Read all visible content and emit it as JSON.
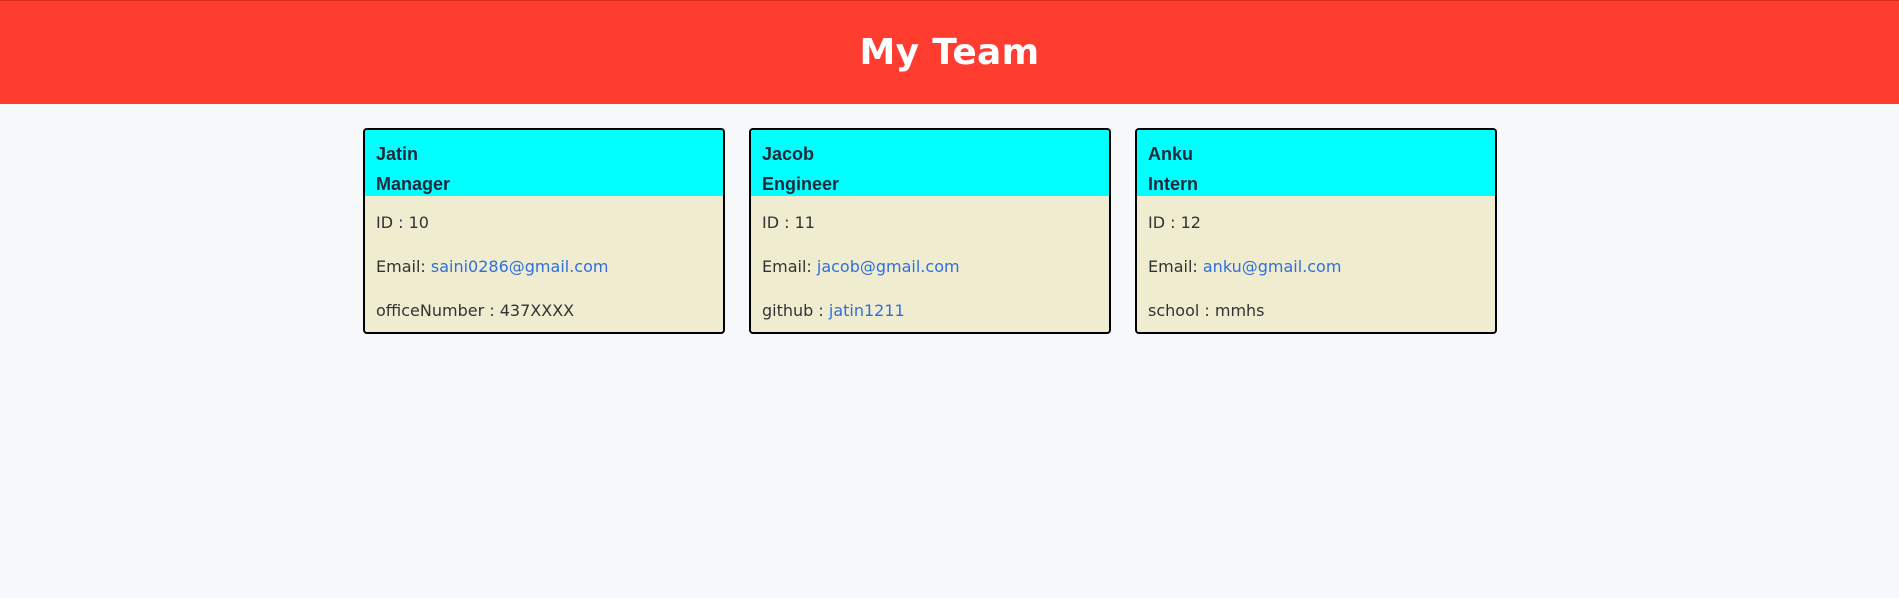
{
  "header": {
    "title": "My Team"
  },
  "cards": [
    {
      "name": "Jatin",
      "role": "Manager",
      "id_label": "ID : ",
      "id_value": "10",
      "email_label": "Email: ",
      "email_value": "saini0286@gmail.com",
      "extra_label": "officeNumber : ",
      "extra_value": "437XXXX"
    },
    {
      "name": "Jacob",
      "role": "Engineer",
      "id_label": "ID : ",
      "id_value": "11",
      "email_label": "Email: ",
      "email_value": "jacob@gmail.com",
      "extra_label": "github : ",
      "extra_value": "jatin1211"
    },
    {
      "name": "Anku",
      "role": "Intern",
      "id_label": "ID : ",
      "id_value": "12",
      "email_label": "Email: ",
      "email_value": "anku@gmail.com",
      "extra_label": "school : ",
      "extra_value": "mmhs"
    }
  ],
  "colors": {
    "header_bg": "#ff3c30",
    "card_head_bg": "#00ffff",
    "card_body_bg": "#efecd0",
    "link": "#2f6fdc",
    "page_bg": "#f7f8fa"
  }
}
